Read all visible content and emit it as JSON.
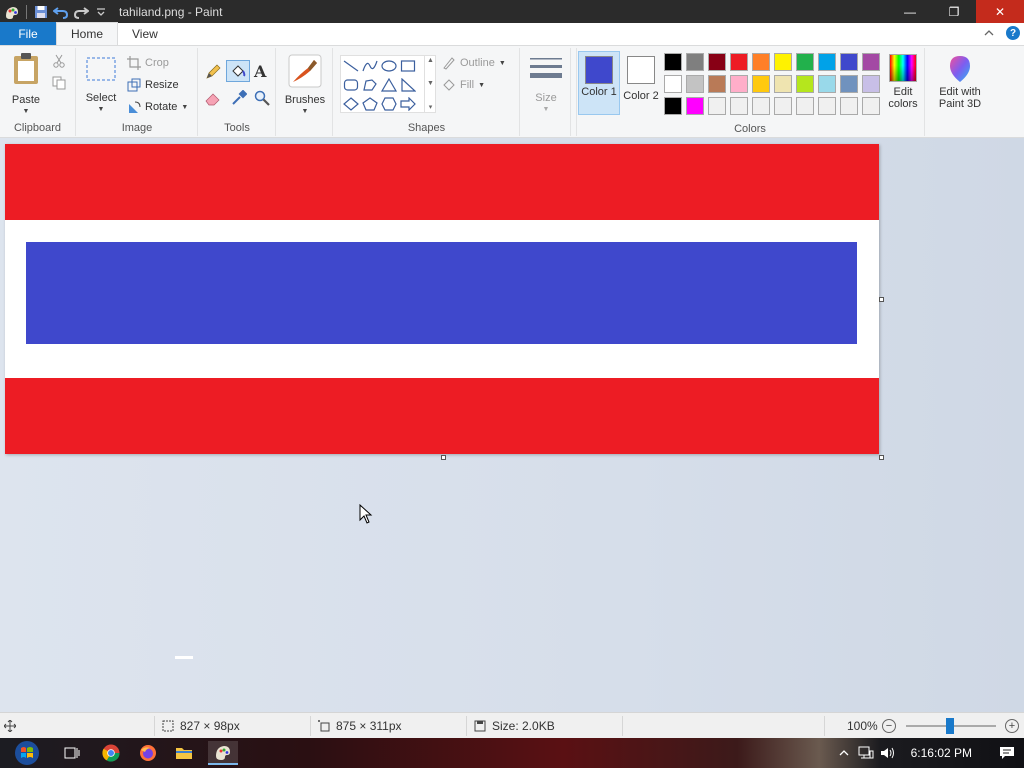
{
  "window": {
    "title": "tahiland.png - Paint",
    "controls": {
      "minimize": "—",
      "maximize": "❐",
      "close": "✕"
    }
  },
  "tabs": {
    "file": "File",
    "home": "Home",
    "view": "View"
  },
  "ribbon": {
    "clipboard": {
      "label": "Clipboard",
      "paste": "Paste"
    },
    "image": {
      "label": "Image",
      "select": "Select",
      "crop": "Crop",
      "resize": "Resize",
      "rotate": "Rotate"
    },
    "tools": {
      "label": "Tools"
    },
    "brushes": {
      "label": "Brushes"
    },
    "shapes": {
      "label": "Shapes",
      "outline": "Outline",
      "fill": "Fill"
    },
    "size": {
      "label": "Size"
    },
    "colors": {
      "label": "Colors",
      "color1": "Color 1",
      "color2": "Color 2",
      "edit_colors": "Edit colors",
      "edit_paint3d": "Edit with Paint 3D",
      "color1_value": "#3f48cc",
      "color2_value": "#ffffff",
      "palette": [
        "#000000",
        "#7f7f7f",
        "#880015",
        "#ed1c24",
        "#ff7f27",
        "#fff200",
        "#22b14c",
        "#00a2e8",
        "#3f48cc",
        "#a349a4",
        "#ffffff",
        "#c3c3c3",
        "#b97a57",
        "#ffaec9",
        "#ffc90e",
        "#efe4b0",
        "#b5e61d",
        "#99d9ea",
        "#7092be",
        "#c8bfe7",
        "#000000",
        "#ff00ff",
        "#f0f0f0",
        "#f0f0f0",
        "#f0f0f0",
        "#f0f0f0",
        "#f0f0f0",
        "#f0f0f0",
        "#f0f0f0",
        "#f0f0f0"
      ]
    }
  },
  "canvas": {
    "colors": {
      "red": "#ed1c24",
      "white": "#ffffff",
      "blue": "#3f48cc"
    }
  },
  "status": {
    "selection_size": "827 × 98px",
    "image_size": "875 × 311px",
    "file_size": "Size: 2.0KB",
    "zoom": "100%"
  },
  "taskbar": {
    "time": "6:16:02 PM"
  }
}
